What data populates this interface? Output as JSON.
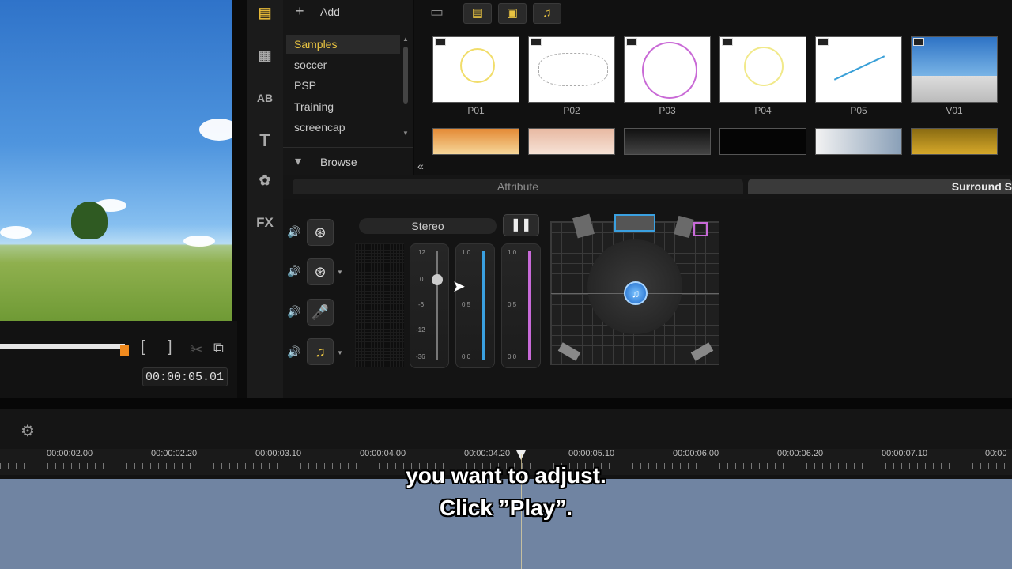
{
  "preview": {
    "timecode": "00:00:05.01",
    "mark_in": "[",
    "mark_out": "]"
  },
  "library": {
    "toolbar_icons": [
      "media-icon",
      "transition-icon",
      "title-icon",
      "text-icon",
      "graphic-icon",
      "filter-icon"
    ],
    "title_label": "T",
    "fx_label": "FX",
    "add_label": "Add",
    "browse_label": "Browse",
    "folders": [
      "Samples",
      "soccer",
      "PSP",
      "Training",
      "screencap"
    ],
    "selected_folder": "Samples",
    "thumbnails_row1": [
      {
        "label": "P01"
      },
      {
        "label": "P02"
      },
      {
        "label": "P03"
      },
      {
        "label": "P04"
      },
      {
        "label": "P05"
      },
      {
        "label": "V01"
      }
    ]
  },
  "tabs": {
    "attribute": "Attribute",
    "surround": "Surround S"
  },
  "mixer": {
    "mode_label": "Stereo",
    "fader1_ticks": [
      "12",
      "0",
      "-6",
      "-12",
      "-36"
    ],
    "fader2_ticks": [
      "1.0",
      "0.5",
      "0.0"
    ],
    "fader3_ticks": [
      "1.0",
      "0.5",
      "0.0"
    ],
    "accent_blue": "#3aa0e0",
    "accent_pink": "#c86ad8"
  },
  "timeline": {
    "ruler_labels": [
      "00:00:02.00",
      "00:00:02.20",
      "00:00:03.10",
      "00:00:04.00",
      "00:00:04.20",
      "00:00:05.10",
      "00:00:06.00",
      "00:00:06.20",
      "00:00:07.10",
      "00:00"
    ]
  },
  "subtitle": {
    "line1": "you want to adjust.",
    "line2": "Click ”Play”."
  }
}
